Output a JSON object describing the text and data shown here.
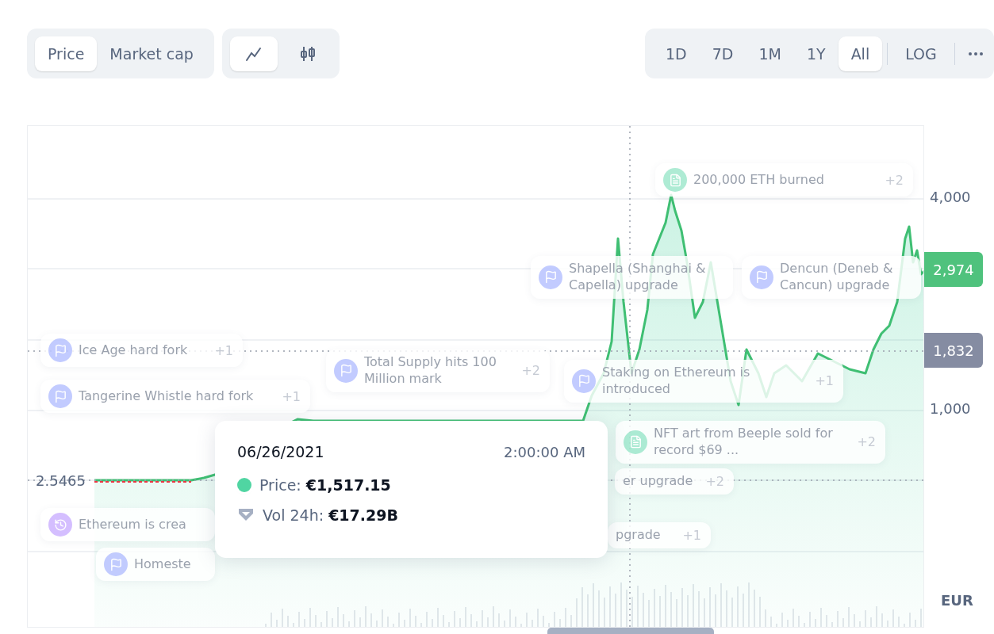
{
  "toolbar": {
    "metric_tabs": [
      {
        "label": "Price",
        "selected": true
      },
      {
        "label": "Market cap",
        "selected": false
      }
    ],
    "chart_type_tabs": [
      {
        "kind": "line",
        "selected": true
      },
      {
        "kind": "candles",
        "selected": false
      }
    ],
    "range_tabs": [
      {
        "label": "1D",
        "selected": false
      },
      {
        "label": "7D",
        "selected": false
      },
      {
        "label": "1M",
        "selected": false
      },
      {
        "label": "1Y",
        "selected": false
      },
      {
        "label": "All",
        "selected": true
      }
    ],
    "scale_button": {
      "label": "LOG",
      "selected": false
    }
  },
  "chart": {
    "y_axis_labels": [
      "4,000",
      "1,000"
    ],
    "current_price": "2,974",
    "crosshair_price": "1,832",
    "start_price": "2.5465",
    "currency": "EUR",
    "events": [
      {
        "title": "200,000 ETH burned",
        "count": "+2",
        "kind": "document"
      },
      {
        "title": "Shapella (Shanghai & Capella) upgrade",
        "kind": "flag"
      },
      {
        "title": "Dencun (Deneb & Cancun) upgrade",
        "kind": "flag"
      },
      {
        "title": "Total Supply hits 100 Million mark",
        "count": "+2",
        "kind": "flag"
      },
      {
        "title": "Staking on Ethereum is introduced",
        "count": "+1",
        "kind": "flag"
      },
      {
        "title": "Ice Age hard fork",
        "count": "+1",
        "kind": "flag"
      },
      {
        "title": "Tangerine Whistle hard fork",
        "count": "+1",
        "kind": "flag"
      },
      {
        "title": "NFT art from Beeple sold for record $69 ...",
        "count": "+2",
        "kind": "document"
      },
      {
        "title": "er upgrade",
        "count": "+2",
        "kind": "none"
      },
      {
        "title": "Ethereum is crea",
        "kind": "history"
      },
      {
        "title": "Homeste",
        "kind": "flag"
      },
      {
        "title": "pgrade",
        "count": "+1",
        "kind": "none"
      }
    ],
    "tooltip": {
      "date": "06/26/2021",
      "time": "2:00:00 AM",
      "rows": [
        {
          "kind": "price",
          "label": "Price:",
          "value": "€1,517.15"
        },
        {
          "kind": "volume",
          "label": "Vol 24h:",
          "value": "€17.29B"
        }
      ]
    }
  }
}
